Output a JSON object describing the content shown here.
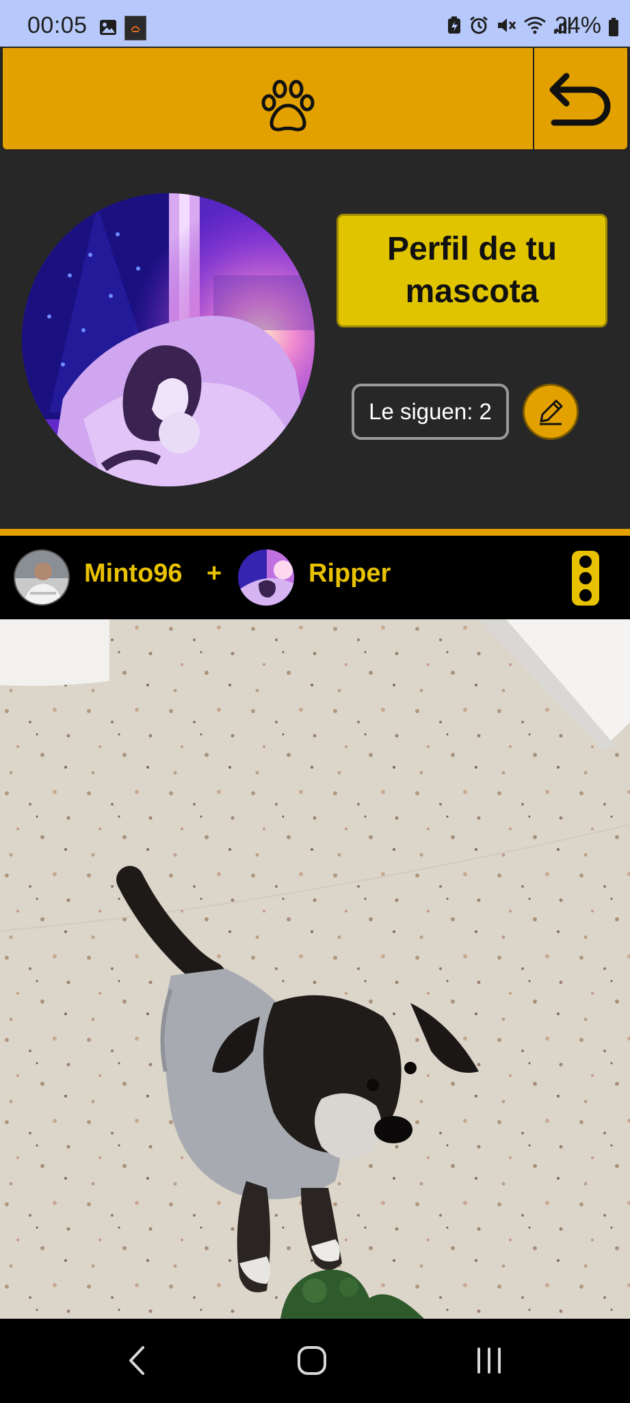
{
  "status_bar": {
    "time": "00:05",
    "battery": "34%",
    "icons": [
      "gallery-icon",
      "app-notification-icon",
      "battery-saver-icon",
      "alarm-icon",
      "mute-icon",
      "wifi-icon",
      "signal-icon",
      "battery-icon"
    ]
  },
  "top_bar": {
    "center_icon": "paw-icon",
    "back_icon": "back-arrow-icon",
    "background": "#e3a100"
  },
  "profile": {
    "title": "Perfil de tu mascota",
    "followers_label": "Le siguen: 2",
    "edit_icon": "pencil-icon"
  },
  "post": {
    "owner_name": "Minto96",
    "separator": "+",
    "pet_name": "Ripper",
    "menu_icon": "more-vertical-icon"
  },
  "nav_bar": {
    "back_icon": "nav-back-icon",
    "home_icon": "nav-home-icon",
    "recents_icon": "nav-recents-icon"
  },
  "colors": {
    "accent": "#e3a100",
    "title_box": "#e0c400",
    "name_text": "#e8c200",
    "background": "#272727",
    "status_bar": "#b7c9fb"
  }
}
